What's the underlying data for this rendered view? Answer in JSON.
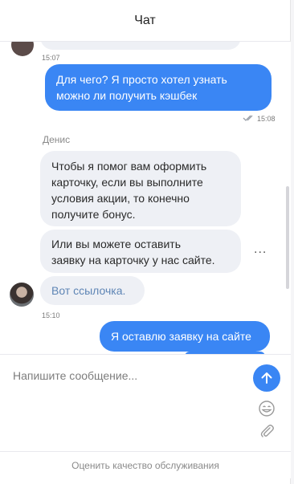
{
  "header": {
    "title": "Чат"
  },
  "messages": [
    {
      "id": "m0",
      "type": "incoming",
      "partial": true,
      "time": "15:07"
    },
    {
      "id": "m1",
      "type": "outgoing",
      "text_line1": "Для чего? Я просто хотел узнать",
      "text_line2": "можно ли получить кэшбек",
      "time": "15:08",
      "status": "read"
    },
    {
      "id": "m2",
      "type": "incoming",
      "sender": "Денис",
      "text_lines": [
        "Чтобы я помог вам оформить",
        "карточку, если вы выполните",
        "условия акции, то конечно",
        "получите бонус."
      ]
    },
    {
      "id": "m3",
      "type": "incoming",
      "text_lines": [
        "Или вы можете оставить",
        "заявку на карточку у нас сайте."
      ],
      "menu": "..."
    },
    {
      "id": "m4",
      "type": "incoming",
      "text": "Вот ссылочка.",
      "time": "15:10"
    },
    {
      "id": "m5",
      "type": "outgoing",
      "text": "Я оставлю заявку на сайте"
    }
  ],
  "composer": {
    "placeholder": "Напишите сообщение..."
  },
  "icons": {
    "send": "arrow-up-icon",
    "emoji": "smile-icon",
    "attach": "paperclip-icon",
    "read": "double-check-icon"
  },
  "footer": {
    "rate_label": "Оценить качество обслуживания"
  },
  "colors": {
    "accent": "#3a86f4",
    "incoming_bg": "#eef0f5",
    "link": "#5e85b5"
  }
}
